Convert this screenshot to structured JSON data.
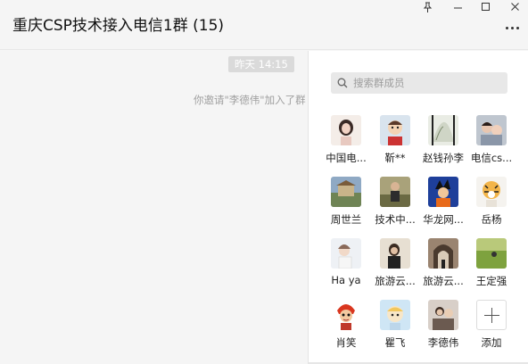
{
  "window": {
    "title": "重庆CSP技术接入电信1群 (15)",
    "pin_icon": "pin-icon",
    "minimize_icon": "minimize-icon",
    "maximize_icon": "maximize-icon",
    "close_icon": "close-icon",
    "more_icon": "more-icon"
  },
  "chat": {
    "time_badge": "昨天 14:15",
    "system_message": "你邀请\"李德伟\"加入了群"
  },
  "members_panel": {
    "search_placeholder": "搜索群成员",
    "members": [
      {
        "name": "中国电..."
      },
      {
        "name": "靳**"
      },
      {
        "name": "赵钱孙李"
      },
      {
        "name": "电信cs..."
      },
      {
        "name": "周世兰"
      },
      {
        "name": "技术中..."
      },
      {
        "name": "华龙网..."
      },
      {
        "name": "岳杨"
      },
      {
        "name": "Ha ya"
      },
      {
        "name": "旅游云..."
      },
      {
        "name": "旅游云..."
      },
      {
        "name": "王定强"
      },
      {
        "name": "肖笑"
      },
      {
        "name": "瞿飞"
      },
      {
        "name": "李德伟"
      }
    ],
    "add_label": "添加"
  },
  "colors": {
    "background": "#f5f5f5",
    "panel": "#ffffff",
    "time_badge": "#dadada",
    "system_text": "#a0a0a0"
  }
}
